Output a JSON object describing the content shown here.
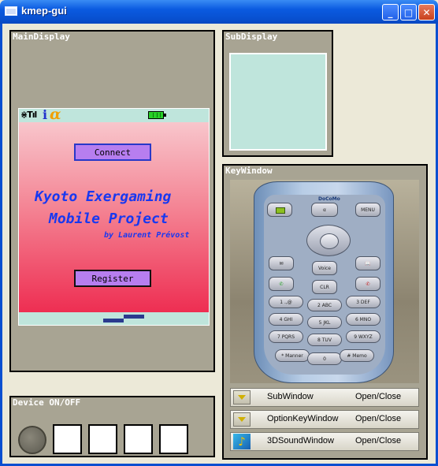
{
  "window": {
    "title": "kmep-gui",
    "accent": "#0a5ae0"
  },
  "titlebar_buttons": {
    "minimize": "_",
    "maximize": "□",
    "close": "✕"
  },
  "main_display": {
    "label": "MainDisplay",
    "connect_label": "Connect",
    "headline_line1": "Kyoto Exergaming",
    "headline_line2": "Mobile Project",
    "byline": "by Laurent Prévost",
    "register_label": "Register",
    "colors": {
      "screen_bg": "#bfe5dc",
      "gradient_top": "#f8c6cc",
      "gradient_bottom": "#ee2e52",
      "text": "#1838f0",
      "button": "#b77eef"
    }
  },
  "sub_display": {
    "label": "SubDisplay"
  },
  "key_window": {
    "label": "KeyWindow",
    "brand": "DoCoMo",
    "keys": {
      "menu": "MENU",
      "alpha": "α",
      "voice": "Voice",
      "clr": "CLR",
      "k1": "1 .,@",
      "k2": "2 ABC",
      "k3": "3 DEF",
      "k4": "4 GHI",
      "k5": "5 JKL",
      "k6": "6 MNO",
      "k7": "7 PQRS",
      "k8": "8 TUV",
      "k9": "9 WXYZ",
      "kstar": "* Manner",
      "k0": "0",
      "khash": "# Memo"
    },
    "buttons": [
      {
        "label": "SubWindow",
        "action": "Open/Close",
        "icon": "triangle-down-icon"
      },
      {
        "label": "OptionKeyWindow",
        "action": "Open/Close",
        "icon": "triangle-down-icon"
      },
      {
        "label": "3DSoundWindow",
        "action": "Open/Close",
        "icon": "music-note-icon"
      }
    ]
  },
  "device": {
    "label": "Device ON/OFF"
  }
}
